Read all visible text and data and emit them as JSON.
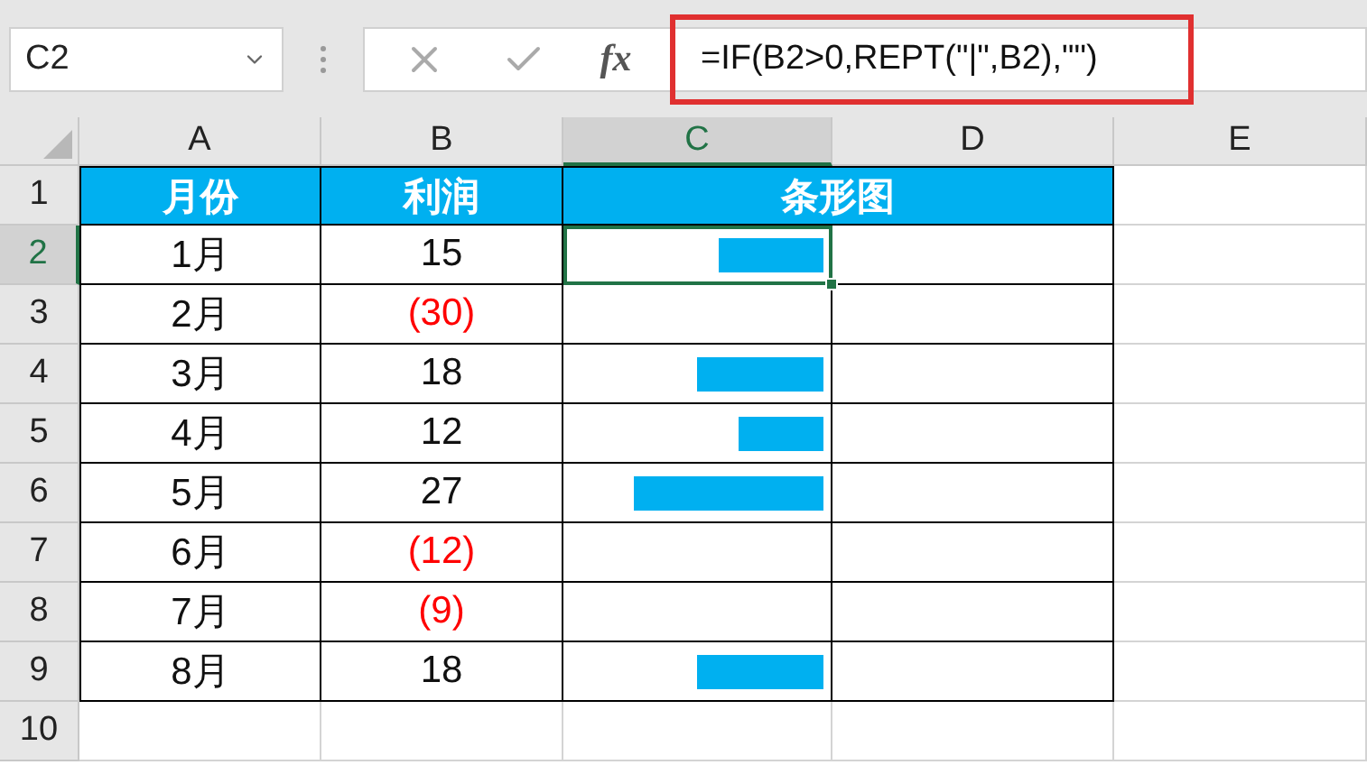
{
  "name_box": {
    "value": "C2"
  },
  "formula_bar": {
    "fx": "fx",
    "value": "=IF(B2>0,REPT(\"|\",B2),\"\")",
    "highlighted": true
  },
  "columns": [
    {
      "label": "A",
      "selected": false
    },
    {
      "label": "B",
      "selected": false
    },
    {
      "label": "C",
      "selected": true
    },
    {
      "label": "D",
      "selected": false
    },
    {
      "label": "E",
      "selected": false
    }
  ],
  "header_row": {
    "label": "1",
    "selected": false,
    "cells": [
      "月份",
      "利润",
      "条形图"
    ]
  },
  "rows": [
    {
      "label": "2",
      "selected": true,
      "month": "1月",
      "profit": "15",
      "negative": false,
      "level": 0.405,
      "active_cell": true
    },
    {
      "label": "3",
      "selected": false,
      "month": "2月",
      "profit": "(30)",
      "negative": true,
      "active_cell": false
    },
    {
      "label": "4",
      "selected": false,
      "month": "3月",
      "profit": "18",
      "negative": false,
      "level": 0.486,
      "active_cell": false
    },
    {
      "label": "5",
      "selected": false,
      "month": "4月",
      "profit": "12",
      "negative": false,
      "level": 0.324,
      "active_cell": false
    },
    {
      "label": "6",
      "selected": false,
      "month": "5月",
      "profit": "27",
      "negative": false,
      "level": 0.73,
      "active_cell": false
    },
    {
      "label": "7",
      "selected": false,
      "month": "6月",
      "profit": "(12)",
      "negative": true,
      "active_cell": false
    },
    {
      "label": "8",
      "selected": false,
      "month": "7月",
      "profit": "(9)",
      "negative": true,
      "active_cell": false
    },
    {
      "label": "9",
      "selected": false,
      "month": "8月",
      "profit": "18",
      "negative": false,
      "level": 0.486,
      "active_cell": false
    }
  ],
  "empty_rows": [
    {
      "label": "10",
      "selected": false
    }
  ]
}
